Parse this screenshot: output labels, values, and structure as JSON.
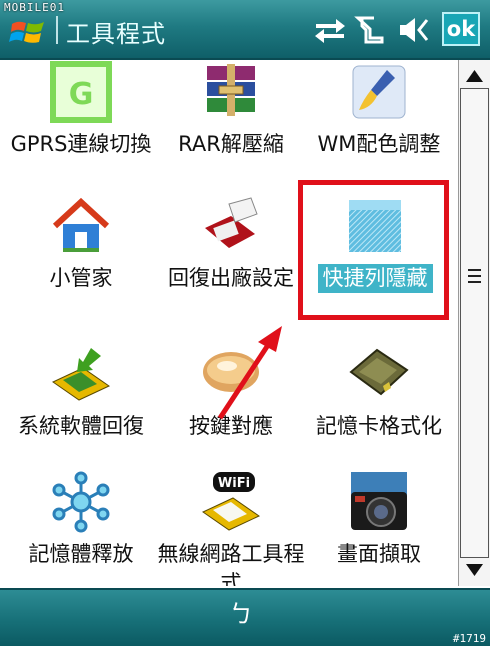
{
  "watermark": "MOBILE01",
  "title": "工具程式",
  "ok_label": "ok",
  "status_icons": [
    "connectivity-icon",
    "signal-icon",
    "volume-icon"
  ],
  "apps": [
    {
      "label": "GPRS連線切換",
      "icon": "gprs-icon"
    },
    {
      "label": "RAR解壓縮",
      "icon": "winrar-icon"
    },
    {
      "label": "WM配色調整",
      "icon": "paint-icon"
    },
    {
      "label": "小管家",
      "icon": "home-icon"
    },
    {
      "label": "回復出廠設定",
      "icon": "reset-device-icon"
    },
    {
      "label": "快捷列隱藏",
      "icon": "hide-taskbar-icon",
      "selected": true
    },
    {
      "label": "系統軟體回復",
      "icon": "restore-icon"
    },
    {
      "label": "按鍵對應",
      "icon": "button-map-icon"
    },
    {
      "label": "記憶卡格式化",
      "icon": "memory-card-icon"
    },
    {
      "label": "記憶體釋放",
      "icon": "memory-free-icon"
    },
    {
      "label": "無線網路工具程式",
      "icon": "wifi-icon"
    },
    {
      "label": "畫面擷取",
      "icon": "camera-icon"
    }
  ],
  "softkey_label": "ㄅ",
  "corner_tag": "#1719",
  "colors": {
    "title_bar": "#1f7a82",
    "highlight": "#e0101a",
    "selection": "#3fb4c8"
  }
}
